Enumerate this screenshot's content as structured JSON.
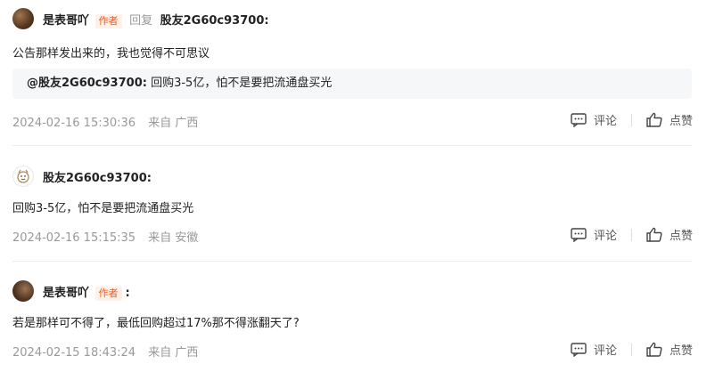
{
  "comments": [
    {
      "author": "是表哥吖",
      "author_tag": "作者",
      "reply_word": "回复",
      "reply_target": "股友2G60c93700:",
      "text": "公告那样发出来的，我也觉得不可思议",
      "quote": {
        "name": "@股友2G60c93700:",
        "text": "回购3-5亿，怕不是要把流通盘买光"
      },
      "time": "2024-02-16 15:30:36",
      "source": "来自 广西",
      "comment_label": "评论",
      "like_label": "点赞"
    },
    {
      "author": "股友2G60c93700:",
      "text": "回购3-5亿，怕不是要把流通盘买光",
      "time": "2024-02-16 15:15:35",
      "source": "来自 安徽",
      "comment_label": "评论",
      "like_label": "点赞"
    },
    {
      "author": "是表哥吖",
      "author_tag": "作者",
      "colon": ":",
      "text": "若是那样可不得了，最低回购超过17%那不得涨翻天了?",
      "time": "2024-02-15 18:43:24",
      "source": "来自 广西",
      "comment_label": "评论",
      "like_label": "点赞"
    }
  ]
}
